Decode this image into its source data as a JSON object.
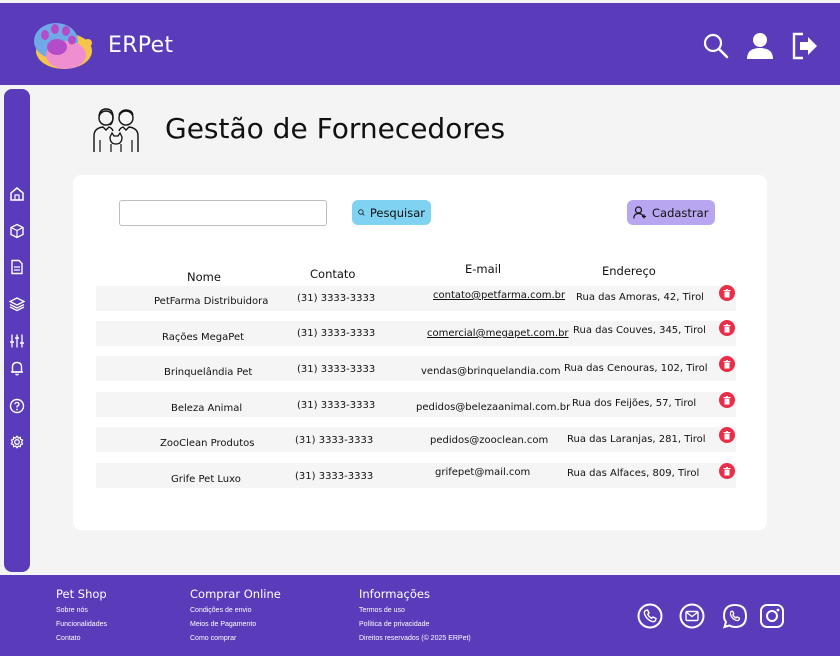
{
  "header": {
    "app_title": "ERPet",
    "icons": [
      "search-icon",
      "user-icon",
      "logout-icon"
    ]
  },
  "sidebar": {
    "icons": [
      "home-icon",
      "box-icon",
      "document-icon",
      "layers-icon",
      "sliders-icon",
      "bell-icon",
      "help-icon",
      "settings-icon"
    ]
  },
  "page": {
    "title": "Gestão de Fornecedores",
    "icon": "people-with-pet-icon"
  },
  "toolbar": {
    "search_placeholder": "",
    "search_value": "",
    "search_label": "Pesquisar",
    "add_label": "Cadastrar"
  },
  "table": {
    "headers": {
      "name": "Nome",
      "contact": "Contato",
      "email": "E-mail",
      "address": "Endereço"
    },
    "rows": [
      {
        "name": "PetFarma Distribuidora",
        "contact": "(31) 3333-3333",
        "email": "contato@petfarma.com.br",
        "address": "Rua das Amoras, 42, Tirol"
      },
      {
        "name": "Rações MegaPet",
        "contact": "(31) 3333-3333",
        "email": "comercial@megapet.com.br",
        "address": "Rua das Couves, 345, Tirol"
      },
      {
        "name": "Brinquelândia Pet",
        "contact": "(31) 3333-3333",
        "email": "vendas@brinquelandia.com",
        "address": "Rua das Cenouras, 102, Tirol"
      },
      {
        "name": "Beleza Animal",
        "contact": "(31) 3333-3333",
        "email": "pedidos@belezaanimal.com.br",
        "address": "Rua dos Feijões, 57, Tirol"
      },
      {
        "name": "ZooClean Produtos",
        "contact": "(31) 3333-3333",
        "email": "pedidos@zooclean.com",
        "address": "Rua das Laranjas, 281, Tirol"
      },
      {
        "name": "Grife Pet Luxo",
        "contact": "(31) 3333-3333",
        "email": "grifepet@mail.com",
        "address": "Rua das Alfaces, 809, Tirol"
      }
    ]
  },
  "footer": {
    "col1": {
      "title": "Pet Shop",
      "links": [
        "Sobre nós",
        "Funcionalidades",
        "Contato"
      ]
    },
    "col2": {
      "title": "Comprar Online",
      "links": [
        "Condições de envio",
        "Meios de Pagamento",
        "Como comprar"
      ]
    },
    "col3": {
      "title": "Informações",
      "links": [
        "Termos de uso",
        "Política de privacidade",
        "Direitos reservados (© 2025 ERPet)"
      ]
    },
    "social": [
      "phone-icon",
      "email-icon",
      "whatsapp-icon",
      "instagram-icon"
    ]
  },
  "colors": {
    "primary": "#5a3bb9",
    "search_button": "#7fd2f2",
    "add_button": "#b9a6f0",
    "delete": "#ea2e4a"
  }
}
